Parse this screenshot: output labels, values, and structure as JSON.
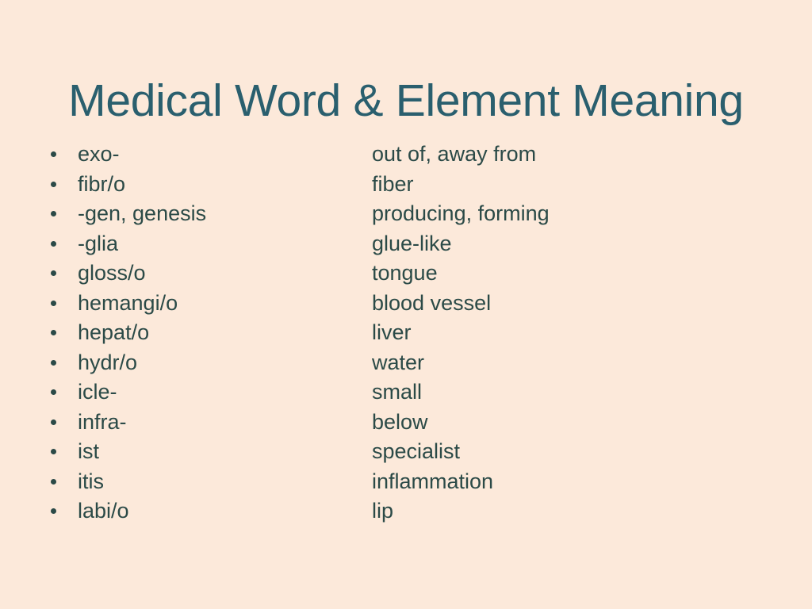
{
  "slide": {
    "title": "Medical Word & Element Meaning",
    "background_color": "#fce9da",
    "title_color": "#2a5f6e",
    "body_color": "#2b4a47",
    "bullet_glyph": "round-bullet",
    "entries": [
      {
        "term": "exo-",
        "meaning": "out of, away from"
      },
      {
        "term": "fibr/o",
        "meaning": "fiber"
      },
      {
        "term": "-gen, genesis",
        "meaning": "producing, forming"
      },
      {
        "term": "-glia",
        "meaning": "glue-like"
      },
      {
        "term": "gloss/o",
        "meaning": "tongue"
      },
      {
        "term": "hemangi/o",
        "meaning": "blood vessel"
      },
      {
        "term": "hepat/o",
        "meaning": "liver"
      },
      {
        "term": "hydr/o",
        "meaning": "water"
      },
      {
        "term": "icle-",
        "meaning": "small"
      },
      {
        "term": "infra-",
        "meaning": "below"
      },
      {
        "term": "ist",
        "meaning": "specialist"
      },
      {
        "term": "itis",
        "meaning": "inflammation"
      },
      {
        "term": "labi/o",
        "meaning": "lip"
      }
    ]
  }
}
